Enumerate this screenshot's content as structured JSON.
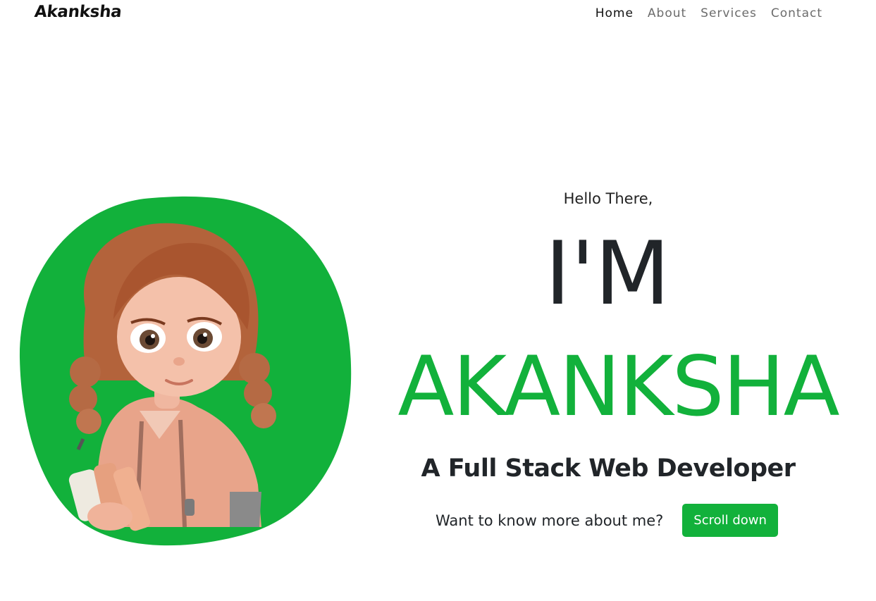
{
  "brand": {
    "name": "Akanksha"
  },
  "nav": {
    "items": [
      {
        "label": "Home",
        "active": true
      },
      {
        "label": "About",
        "active": false
      },
      {
        "label": "Services",
        "active": false
      },
      {
        "label": "Contact",
        "active": false
      }
    ]
  },
  "hero": {
    "greeting": "Hello There,",
    "intro": "I'M",
    "name": "AKANKSHA",
    "role": "A Full Stack Web Developer",
    "cta_text": "Want to know more about me?",
    "cta_button": "Scroll down",
    "image_icon": "cartoon-girl-avatar"
  },
  "colors": {
    "accent": "#12b13b",
    "text": "#212529",
    "nav_inactive": "#6c6c6c"
  }
}
